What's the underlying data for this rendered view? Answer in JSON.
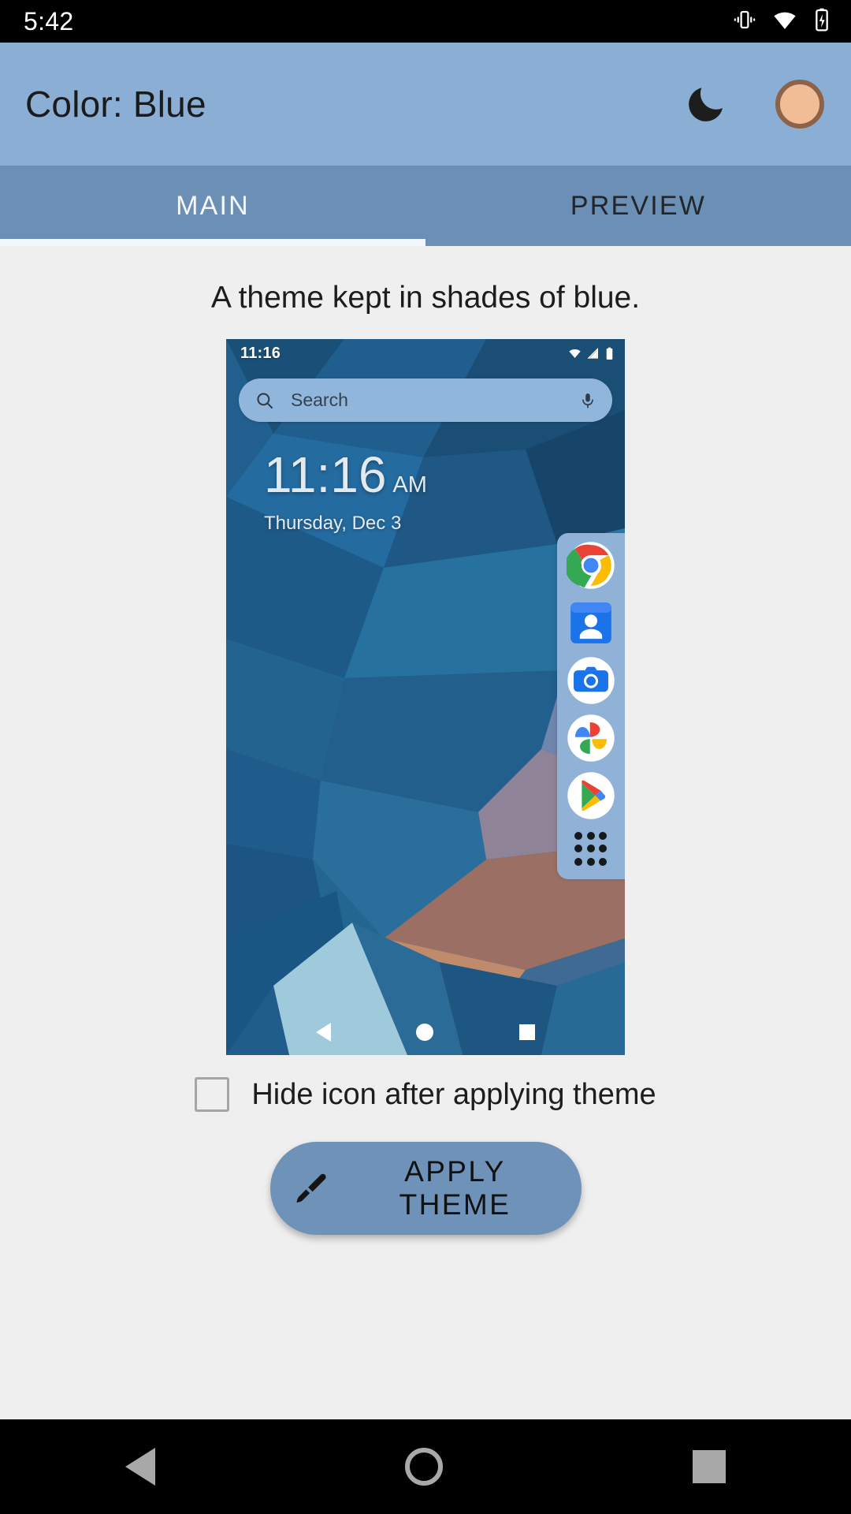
{
  "status_bar": {
    "time": "5:42",
    "icons": [
      "vibrate-icon",
      "wifi-icon",
      "battery-charging-icon"
    ]
  },
  "app_bar": {
    "title": "Color: Blue",
    "dark_mode_icon": "moon-icon",
    "avatar_icon": "account-avatar",
    "background_color": "#8AAED4",
    "avatar_fill": "#F0BD97",
    "avatar_border": "#8C6349"
  },
  "tabs": {
    "items": [
      {
        "label": "MAIN",
        "selected": true
      },
      {
        "label": "PREVIEW",
        "selected": false
      }
    ],
    "background_color": "#6B8FB5",
    "indicator_color": "#F3F7FB"
  },
  "main": {
    "description": "A theme kept in shades of blue.",
    "checkbox": {
      "label": "Hide icon after applying theme",
      "checked": false
    },
    "apply_button": {
      "label": "APPLY THEME",
      "icon": "brush-icon",
      "color": "#6E92B8"
    }
  },
  "preview": {
    "status_bar": {
      "time": "11:16",
      "icons": [
        "wifi-icon",
        "signal-icon",
        "battery-icon"
      ]
    },
    "search_widget": {
      "placeholder": "Search",
      "left_icon": "search-icon",
      "right_icon": "microphone-icon",
      "color": "#90B6DC"
    },
    "clock_widget": {
      "time": "11:16",
      "ampm": "AM",
      "date": "Thursday, Dec 3"
    },
    "dock": {
      "background_color": "#8FB2D6",
      "apps": [
        {
          "name": "chrome-icon"
        },
        {
          "name": "contacts-icon"
        },
        {
          "name": "camera-icon"
        },
        {
          "name": "photos-icon"
        },
        {
          "name": "play-store-icon"
        },
        {
          "name": "app-drawer-icon"
        }
      ]
    },
    "nav_bar": {
      "back": "back-icon",
      "home": "home-icon",
      "recents": "recents-icon"
    }
  },
  "system_nav": {
    "back": "back-icon",
    "home": "home-icon",
    "recents": "recents-icon"
  }
}
